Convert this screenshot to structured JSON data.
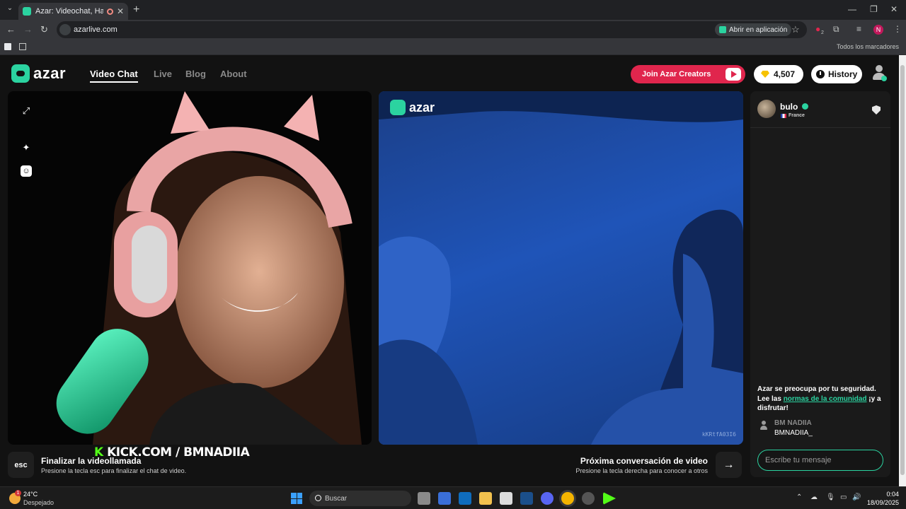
{
  "browser": {
    "tab_title": "Azar: Videochat, Haz nuevo",
    "url": "azarlive.com",
    "open_in_app": "Abrir en aplicación",
    "bookmarks_all": "Todos los marcadores",
    "extension_badge": "2"
  },
  "site": {
    "logo_text": "azar",
    "nav": [
      "Video Chat",
      "Live",
      "Blog",
      "About"
    ],
    "creators_button": "Join Azar Creators",
    "gems": "4,507",
    "history_button": "History"
  },
  "left_video": {
    "stream_tag_k": "K",
    "stream_tag": "KICK.COM / BMNADIIA"
  },
  "right_video": {
    "logo_text": "azar",
    "watermark": "kKRtfA03I6"
  },
  "controls": {
    "esc_key": "esc",
    "end_title": "Finalizar la videollamada",
    "end_sub": "Presione la tecla esc para finalizar el chat de video.",
    "next_title": "Próxima conversación de video",
    "next_sub": "Presione la tecla derecha para conocer a otros"
  },
  "chat": {
    "peer_name": "bulo",
    "peer_country": "France",
    "safety_pre": "Azar se preocupa por tu seguridad. Lee las ",
    "safety_link": "normas de la comunidad",
    "safety_post": " ¡y a disfrutar!",
    "message_author": "BM NADIIA",
    "message_text": "BMNADIIA_",
    "input_placeholder": "Escribe tu mensaje"
  },
  "taskbar": {
    "weather_badge": "1",
    "temperature": "24°C",
    "condition": "Despejado",
    "search_placeholder": "Buscar",
    "time": "0:04",
    "date": "18/09/2025"
  },
  "colors": {
    "accent": "#2bd3a0",
    "creators_red": "#e0264d",
    "kick_green": "#53fc18"
  }
}
